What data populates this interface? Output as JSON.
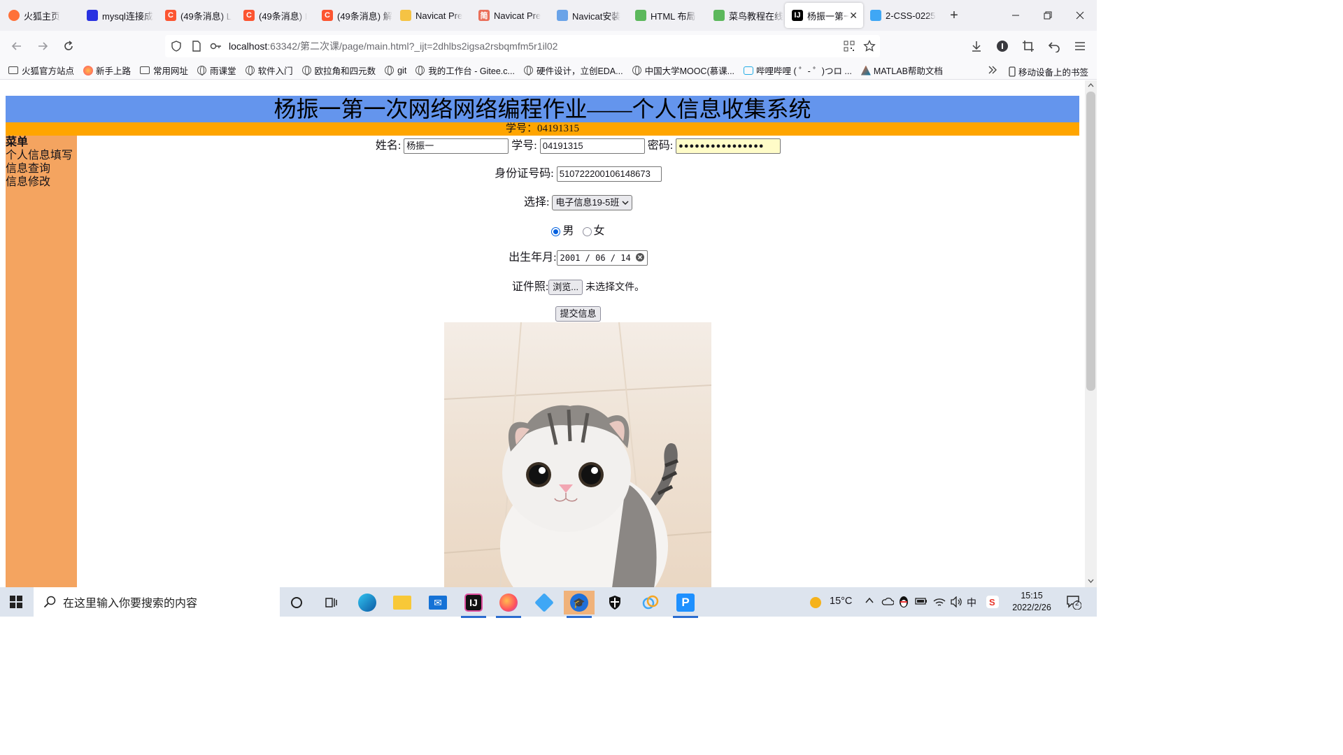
{
  "tabs": [
    {
      "title": "火狐主页",
      "icon": "firefox-icon",
      "color": "#ff7139",
      "glyph": "",
      "active": false
    },
    {
      "title": "mysql连接成",
      "icon": "baidu-paw-icon",
      "color": "#2932e1",
      "glyph": "",
      "active": false
    },
    {
      "title": "(49条消息) L",
      "icon": "csdn-icon",
      "color": "#fc5531",
      "glyph": "C",
      "active": false
    },
    {
      "title": "(49条消息) I",
      "icon": "csdn-icon",
      "color": "#fc5531",
      "glyph": "C",
      "active": false
    },
    {
      "title": "(49条消息) 解",
      "icon": "csdn-icon",
      "color": "#fc5531",
      "glyph": "C",
      "active": false
    },
    {
      "title": "Navicat Pre",
      "icon": "navicat-icon",
      "color": "#f5c344",
      "glyph": "",
      "active": false
    },
    {
      "title": "Navicat Pre",
      "icon": "jianshu-icon",
      "color": "#ea6f5a",
      "glyph": "简",
      "active": false
    },
    {
      "title": "Navicat安装",
      "icon": "navicat-icon",
      "color": "#6aa3e8",
      "glyph": "",
      "active": false
    },
    {
      "title": "HTML 布局",
      "icon": "runoob-icon",
      "color": "#5cb85c",
      "glyph": "",
      "active": false
    },
    {
      "title": "菜鸟教程在线",
      "icon": "runoob-icon",
      "color": "#5cb85c",
      "glyph": "",
      "active": false
    },
    {
      "title": "杨振一第一",
      "icon": "jetbrains-icon",
      "color": "#000000",
      "glyph": "IJ",
      "active": true
    },
    {
      "title": "2-CSS-0225",
      "icon": "diamond-icon",
      "color": "#3fa7f5",
      "glyph": "",
      "active": false
    }
  ],
  "url": {
    "host": "localhost",
    "rest": ":63342/第二次课/page/main.html?_ijt=2dhlbs2igsa2rsbqmfm5r1il02"
  },
  "bookmarks": [
    {
      "label": "火狐官方站点",
      "icon": "folder-icon"
    },
    {
      "label": "新手上路",
      "icon": "firefox-icon"
    },
    {
      "label": "常用网址",
      "icon": "folder-icon"
    },
    {
      "label": "雨课堂",
      "icon": "globe-icon"
    },
    {
      "label": "软件入门",
      "icon": "globe-icon"
    },
    {
      "label": "欧拉角和四元数",
      "icon": "globe-icon"
    },
    {
      "label": "git",
      "icon": "globe-icon"
    },
    {
      "label": "我的工作台 - Gitee.c...",
      "icon": "globe-icon"
    },
    {
      "label": "硬件设计，立创EDA...",
      "icon": "globe-icon"
    },
    {
      "label": "中国大学MOOC(慕课...",
      "icon": "globe-icon"
    },
    {
      "label": "哔哩哔哩 ( ゜- ゜)つロ ...",
      "icon": "bilibili-icon"
    },
    {
      "label": "MATLAB帮助文档",
      "icon": "matlab-icon"
    }
  ],
  "bookmarks_mobile": "移动设备上的书签",
  "page": {
    "header": "杨振一第一次网络网络编程作业——个人信息收集系统",
    "subheader": "学号：04191315",
    "menu": {
      "title": "菜单",
      "items": [
        "个人信息填写",
        "信息查询",
        "信息修改"
      ]
    },
    "form": {
      "name_label": "姓名:",
      "name_value": "杨振一",
      "id_label": "学号:",
      "id_value": "04191315",
      "pwd_label": "密码:",
      "pwd_value": "●●●●●●●●●●●●●●●●",
      "idcard_label": "身份证号码:",
      "idcard_value": "510722200106148673",
      "select_label": "选择:",
      "select_value": "电子信息19-5班",
      "gender_male": "男",
      "gender_female": "女",
      "birth_label": "出生年月:",
      "birth_value": "2001 / 06 / 14",
      "photo_label": "证件照:",
      "browse_label": "浏览...",
      "no_file": "未选择文件。",
      "submit_label": "提交信息"
    }
  },
  "taskbar": {
    "search_placeholder": "在这里输入你要搜索的内容",
    "temperature": "15°C",
    "ime": "中",
    "time": "15:15",
    "date": "2022/2/26",
    "notifications": "2"
  }
}
